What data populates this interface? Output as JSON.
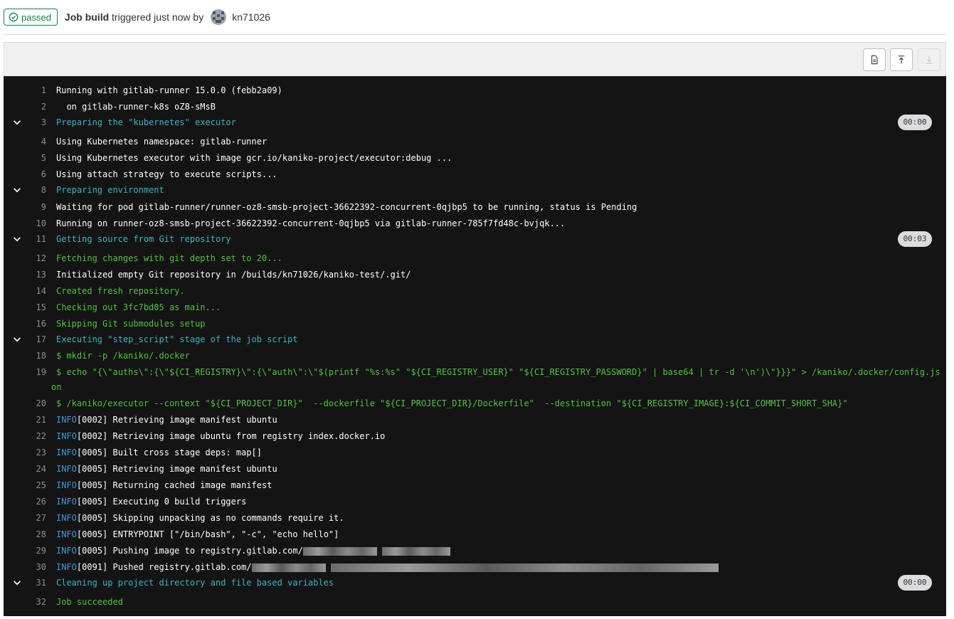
{
  "header": {
    "status_label": "passed",
    "job_name": "Job build",
    "trigger_text": " triggered just now by ",
    "username": "kn71026"
  },
  "toolbar": {
    "buttons": [
      "file-text-icon",
      "scroll-to-top-icon",
      "scroll-to-bottom-icon"
    ]
  },
  "log": {
    "lines": [
      {
        "n": "1",
        "t": "Running with gitlab-runner 15.0.0 (febb2a09)",
        "c": "white"
      },
      {
        "n": "2",
        "t": "  on gitlab-runner-k8s oZ8-sMsB",
        "c": "white"
      },
      {
        "n": "3",
        "t": "Preparing the \"kubernetes\" executor",
        "c": "cyan",
        "section": true,
        "duration": "00:00"
      },
      {
        "n": "4",
        "t": "Using Kubernetes namespace: gitlab-runner",
        "c": "white"
      },
      {
        "n": "5",
        "t": "Using Kubernetes executor with image gcr.io/kaniko-project/executor:debug ...",
        "c": "white"
      },
      {
        "n": "6",
        "t": "Using attach strategy to execute scripts...",
        "c": "white"
      },
      {
        "n": "8",
        "t": "Preparing environment",
        "c": "cyan",
        "section": true
      },
      {
        "n": "9",
        "t": "Waiting for pod gitlab-runner/runner-oz8-smsb-project-36622392-concurrent-0qjbp5 to be running, status is Pending",
        "c": "white"
      },
      {
        "n": "10",
        "t": "Running on runner-oz8-smsb-project-36622392-concurrent-0qjbp5 via gitlab-runner-785f7fd48c-bvjqk...",
        "c": "white"
      },
      {
        "n": "11",
        "t": "Getting source from Git repository",
        "c": "cyan",
        "section": true,
        "duration": "00:03"
      },
      {
        "n": "12",
        "t": "Fetching changes with git depth set to 20...",
        "c": "green"
      },
      {
        "n": "13",
        "t": "Initialized empty Git repository in /builds/kn71026/kaniko-test/.git/",
        "c": "white"
      },
      {
        "n": "14",
        "t": "Created fresh repository.",
        "c": "green"
      },
      {
        "n": "15",
        "t": "Checking out 3fc7bd05 as main...",
        "c": "green"
      },
      {
        "n": "16",
        "t": "Skipping Git submodules setup",
        "c": "green"
      },
      {
        "n": "17",
        "t": "Executing \"step_script\" stage of the job script",
        "c": "cyan",
        "section": true
      },
      {
        "n": "18",
        "t": "$ mkdir -p /kaniko/.docker",
        "c": "green"
      },
      {
        "n": "19",
        "t": "$ echo \"{\\\"auths\\\":{\\\"${CI_REGISTRY}\\\":{\\\"auth\\\":\\\"$(printf \"%s:%s\" \"${CI_REGISTRY_USER}\" \"${CI_REGISTRY_PASSWORD}\" | base64 | tr -d '\\n')\\\"}}}\" > /kaniko/.docker/config.js",
        "c": "green"
      },
      {
        "n": "",
        "t": "on",
        "c": "green",
        "wrap": true
      },
      {
        "n": "20",
        "t": "$ /kaniko/executor --context \"${CI_PROJECT_DIR}\"  --dockerfile \"${CI_PROJECT_DIR}/Dockerfile\"  --destination \"${CI_REGISTRY_IMAGE}:${CI_COMMIT_SHORT_SHA}\"",
        "c": "green"
      },
      {
        "n": "21",
        "p": "INFO",
        "t": "[0002] Retrieving image manifest ubuntu",
        "c": "white"
      },
      {
        "n": "22",
        "p": "INFO",
        "t": "[0002] Retrieving image ubuntu from registry index.docker.io",
        "c": "white"
      },
      {
        "n": "23",
        "p": "INFO",
        "t": "[0005] Built cross stage deps: map[]",
        "c": "white"
      },
      {
        "n": "24",
        "p": "INFO",
        "t": "[0005] Retrieving image manifest ubuntu",
        "c": "white"
      },
      {
        "n": "25",
        "p": "INFO",
        "t": "[0005] Returning cached image manifest",
        "c": "white"
      },
      {
        "n": "26",
        "p": "INFO",
        "t": "[0005] Executing 0 build triggers",
        "c": "white"
      },
      {
        "n": "27",
        "p": "INFO",
        "t": "[0005] Skipping unpacking as no commands require it.",
        "c": "white"
      },
      {
        "n": "28",
        "p": "INFO",
        "t": "[0005] ENTRYPOINT [\"/bin/bash\", \"-c\", \"echo hello\"]",
        "c": "white"
      },
      {
        "n": "29",
        "p": "INFO",
        "t": "[0005] Pushing image to registry.gitlab.com/",
        "c": "white",
        "redacted": "short"
      },
      {
        "n": "30",
        "p": "INFO",
        "t": "[0091] Pushed registry.gitlab.com/",
        "c": "white",
        "redacted": "long"
      },
      {
        "n": "31",
        "t": "Cleaning up project directory and file based variables",
        "c": "cyan",
        "section": true,
        "duration": "00:00"
      },
      {
        "n": "32",
        "t": "Job succeeded",
        "c": "green"
      }
    ]
  }
}
